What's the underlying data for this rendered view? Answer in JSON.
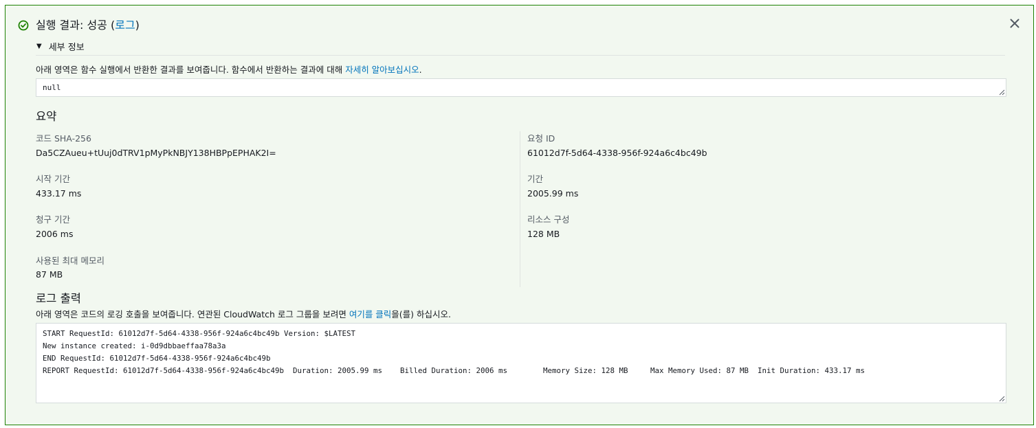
{
  "header": {
    "title_prefix": "실행 결과: 성공 (",
    "log_link": "로그",
    "title_suffix": ")",
    "status_icon": "check-circle-icon",
    "close_icon": "close-icon"
  },
  "details": {
    "toggle_label": "세부 정보",
    "description_prefix": "아래 영역은 함수 실행에서 반환한 결과를 보여줍니다. 함수에서 반환하는 결과에 대해 ",
    "description_link": "자세히 알아보십시오",
    "description_suffix": ".",
    "result_value": "null"
  },
  "summary": {
    "title": "요약",
    "left": [
      {
        "label": "코드 SHA-256",
        "value": "Da5CZAueu+tUuj0dTRV1pMyPkNBJY138HBPpEPHAK2I="
      },
      {
        "label": "시작 기간",
        "value": "433.17 ms"
      },
      {
        "label": "청구 기간",
        "value": "2006 ms"
      },
      {
        "label": "사용된 최대 메모리",
        "value": "87 MB"
      }
    ],
    "right": [
      {
        "label": "요청 ID",
        "value": "61012d7f-5d64-4338-956f-924a6c4bc49b"
      },
      {
        "label": "기간",
        "value": "2005.99 ms"
      },
      {
        "label": "리소스 구성",
        "value": "128 MB"
      }
    ]
  },
  "log": {
    "title": "로그 출력",
    "description_prefix": "아래 영역은 코드의 로깅 호출을 보여줍니다. 연관된 CloudWatch 로그 그룹을 보려면 ",
    "description_link": "여기를 클릭",
    "description_suffix": "을(를) 하십시오.",
    "lines": [
      "START RequestId: 61012d7f-5d64-4338-956f-924a6c4bc49b Version: $LATEST",
      "New instance created: i-0d9dbbaeffaa78a3a",
      "END RequestId: 61012d7f-5d64-4338-956f-924a6c4bc49b",
      "REPORT RequestId: 61012d7f-5d64-4338-956f-924a6c4bc49b  Duration: 2005.99 ms    Billed Duration: 2006 ms        Memory Size: 128 MB     Max Memory Used: 87 MB  Init Duration: 433.17 ms"
    ]
  },
  "colors": {
    "success": "#1d8102",
    "link": "#0073bb",
    "panel_bg": "#f2f8f0"
  }
}
